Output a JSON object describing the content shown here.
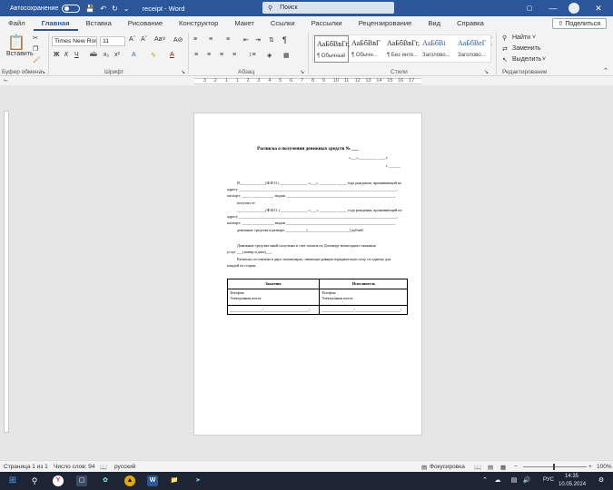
{
  "titlebar": {
    "autosave_label": "Автосохранение",
    "doc_title": "receipt  -  Word",
    "search_placeholder": "Поиск",
    "minimize": "—",
    "maximize": "□",
    "close": "✕"
  },
  "tabs": [
    "Файл",
    "Главная",
    "Вставка",
    "Рисование",
    "Конструктор",
    "Макет",
    "Ссылки",
    "Рассылки",
    "Рецензирование",
    "Вид",
    "Справка"
  ],
  "share_label": "Поделиться",
  "clipboard": {
    "paste_label": "Вставить",
    "group_label": "Буфер обмена"
  },
  "font": {
    "name": "Times New Ron",
    "size": "11",
    "group_label": "Шрифт"
  },
  "paragraph": {
    "group_label": "Абзац"
  },
  "styles": {
    "group_label": "Стили",
    "items": [
      {
        "sample": "АаБбВвГг,",
        "name": "¶ Обычный"
      },
      {
        "sample": "АаБбВвГ",
        "name": "¶ Обычн..."
      },
      {
        "sample": "АаБбВвГг,",
        "name": "¶ Без инте..."
      },
      {
        "sample": "АаБбВі",
        "name": "Заголово..."
      },
      {
        "sample": "АаБбВеГ",
        "name": "Заголово..."
      }
    ]
  },
  "editing": {
    "find": "Найти",
    "replace": "Заменить",
    "select": "Выделить",
    "group_label": "Редактирование"
  },
  "ruler_numbers": [
    "3",
    "2",
    "1",
    "1",
    "2",
    "3",
    "4",
    "5",
    "6",
    "7",
    "8",
    "9",
    "10",
    "11",
    "12",
    "13",
    "14",
    "15",
    "16",
    "17"
  ],
  "document": {
    "heading": "Расписка о получении денежных средств № ___",
    "date_line": "«___»__________ ____г.",
    "city_line": "г. ______",
    "lines": [
      "Я,_____________(Ф.И.О.) ______________, «___» _________ _____ года рождения, проживающий по",
      "адресу ___________________________________________________________________________________,",
      "паспорт: _____ ___________, выдан _________________________________________________________,",
      "получил от",
      "_______________(Ф.И.О.) ______________, «___» _________ _____ года рождения, проживающий по",
      "адресу ___________________________________________________________________________________,",
      "паспорт: _____ ___________, выдан _________________________________________________________,",
      "денежные средства в размере ___________(______________________) рублей.",
      "Денежные средства мной получены в счет оплаты по Договору возмездного оказания",
      "услуг ___(номер и дата)___.",
      "Расписка составлена в двух экземплярах, имеющих равную юридическую силу, по одному для",
      "каждой из сторон."
    ],
    "table": {
      "left_header": "Заказчик",
      "right_header": "Исполнитель",
      "left_phone": "Телефон:",
      "left_email": "Электронная почта:",
      "right_phone": "Телефон:",
      "right_email": "Электронная почта:",
      "left_sign": "_________________/________________________/",
      "right_sign": "_________________/________________________/"
    }
  },
  "statusbar": {
    "page": "Страница 1 из 1",
    "words": "Число слов: 94",
    "language": "русский",
    "focus": "Фокусировка",
    "zoom": "100%"
  },
  "taskbar": {
    "lang": "РУС",
    "time": "14:35",
    "date": "10.05.2024"
  }
}
